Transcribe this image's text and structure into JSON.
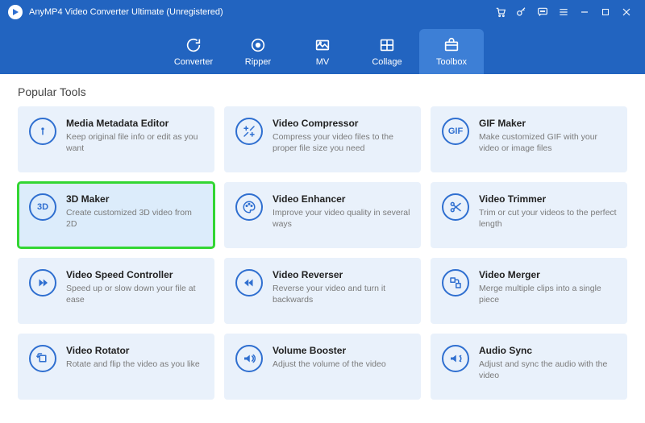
{
  "window": {
    "title": "AnyMP4 Video Converter Ultimate (Unregistered)"
  },
  "nav": {
    "items": [
      {
        "label": "Converter"
      },
      {
        "label": "Ripper"
      },
      {
        "label": "MV"
      },
      {
        "label": "Collage"
      },
      {
        "label": "Toolbox"
      }
    ],
    "active_index": 4
  },
  "section": {
    "title": "Popular Tools"
  },
  "tools": [
    {
      "icon": "info",
      "title": "Media Metadata Editor",
      "desc": "Keep original file info or edit as you want"
    },
    {
      "icon": "compress",
      "title": "Video Compressor",
      "desc": "Compress your video files to the proper file size you need"
    },
    {
      "icon": "gif",
      "title": "GIF Maker",
      "desc": "Make customized GIF with your video or image files"
    },
    {
      "icon": "3d",
      "title": "3D Maker",
      "desc": "Create customized 3D video from 2D",
      "highlight": true
    },
    {
      "icon": "palette",
      "title": "Video Enhancer",
      "desc": "Improve your video quality in several ways"
    },
    {
      "icon": "scissors",
      "title": "Video Trimmer",
      "desc": "Trim or cut your videos to the perfect length"
    },
    {
      "icon": "speed",
      "title": "Video Speed Controller",
      "desc": "Speed up or slow down your file at ease"
    },
    {
      "icon": "rewind",
      "title": "Video Reverser",
      "desc": "Reverse your video and turn it backwards"
    },
    {
      "icon": "merge",
      "title": "Video Merger",
      "desc": "Merge multiple clips into a single piece"
    },
    {
      "icon": "rotate",
      "title": "Video Rotator",
      "desc": "Rotate and flip the video as you like"
    },
    {
      "icon": "volume",
      "title": "Volume Booster",
      "desc": "Adjust the volume of the video"
    },
    {
      "icon": "sync",
      "title": "Audio Sync",
      "desc": "Adjust and sync the audio with the video"
    }
  ]
}
